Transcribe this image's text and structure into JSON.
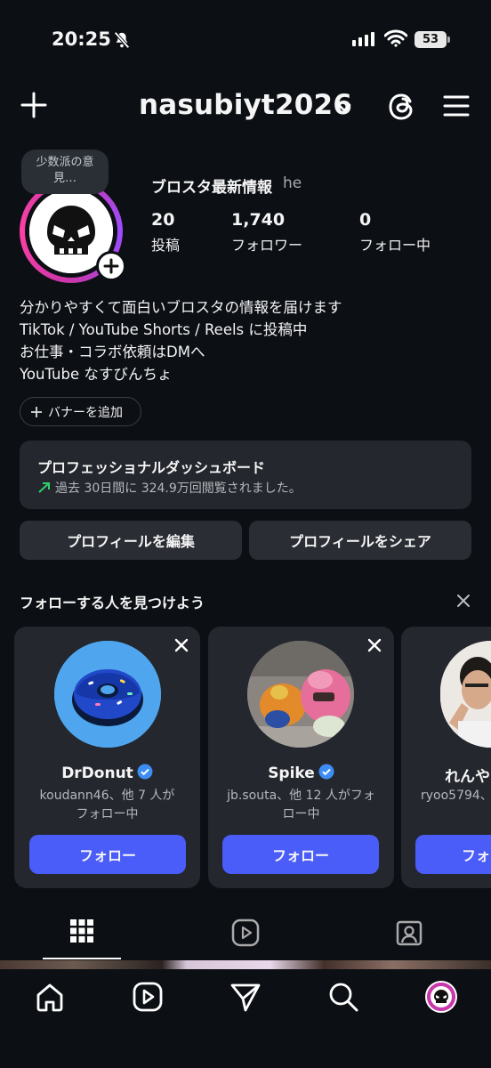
{
  "status_bar": {
    "time": "20:25",
    "battery": "53"
  },
  "header": {
    "username": "nasubiyt2026"
  },
  "profile": {
    "note": "少数派の意見…",
    "display_name": "ブロスタ最新情報",
    "pronoun": "he",
    "stats": [
      {
        "value": "20",
        "label": "投稿"
      },
      {
        "value": "1,740",
        "label": "フォロワー"
      },
      {
        "value": "0",
        "label": "フォロー中"
      }
    ],
    "bio": [
      "分かりやすくて面白いブロスタの情報を届けます",
      "TikTok / YouTube Shorts / Reels に投稿中",
      "お仕事・コラボ依頼はDMへ",
      "YouTube なすびんちょ"
    ],
    "banner_chip": "バナーを追加"
  },
  "dashboard": {
    "title": "プロフェッショナルダッシュボード",
    "subtitle": "過去 30日間に 324.9万回閲覧されました。"
  },
  "buttons": {
    "edit": "プロフィールを編集",
    "share": "プロフィールをシェア"
  },
  "suggestions": {
    "title": "フォローする人を見つけよう",
    "cards": [
      {
        "name": "DrDonut",
        "sub1": "koudann46、他 7 人が",
        "sub2": "フォロー中",
        "follow": "フォロー"
      },
      {
        "name": "Spike",
        "sub1": "jb.souta、他 12 人がフォ",
        "sub2": "ロー中",
        "follow": "フォロー"
      },
      {
        "name": "れんや",
        "sub1": "ryoo5794、",
        "sub2": "",
        "follow": "フォ"
      }
    ]
  },
  "colors": {
    "accent": "#4a5df9",
    "verified": "#3d8df5",
    "ring": "#c837ab",
    "background": "#0c0f14"
  }
}
